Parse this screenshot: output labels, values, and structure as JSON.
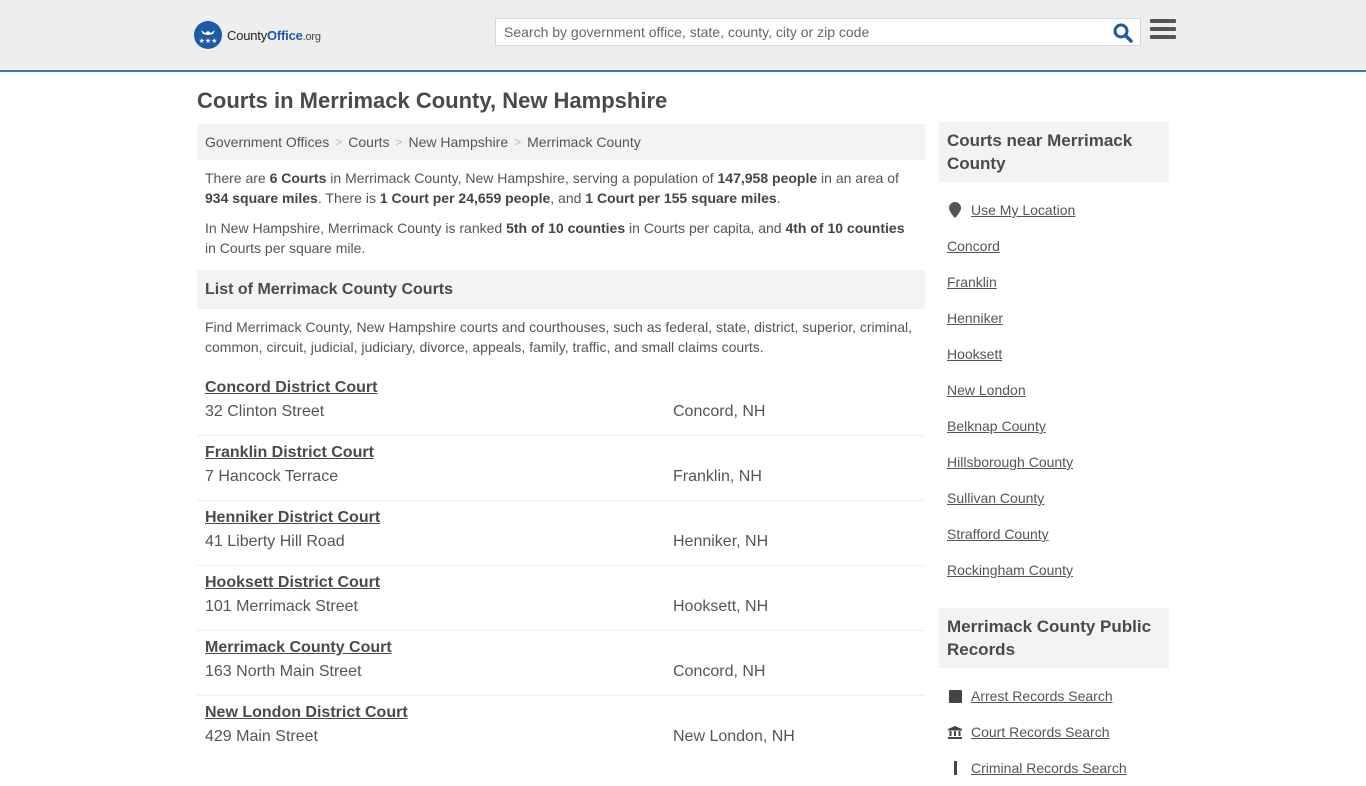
{
  "header": {
    "logo": {
      "part1": "County",
      "part2": "Office",
      "part3": ".org"
    },
    "search_placeholder": "Search by government office, state, county, city or zip code",
    "search_value": "",
    "accent_color": "#3a7aac"
  },
  "page_title": "Courts in Merrimack County, New Hampshire",
  "breadcrumb": [
    {
      "label": "Government Offices"
    },
    {
      "label": "Courts"
    },
    {
      "label": "New Hampshire"
    },
    {
      "label": "Merrimack County"
    }
  ],
  "intro": {
    "p1": {
      "t1": "There are ",
      "b1": "6 Courts",
      "t2": " in Merrimack County, New Hampshire, serving a population of ",
      "b2": "147,958 people",
      "t3": " in an area of ",
      "b3": "934 square miles",
      "t4": ". There is ",
      "b4": "1 Court per 24,659 people",
      "t5": ", and ",
      "b5": "1 Court per 155 square miles",
      "t6": "."
    },
    "p2": {
      "t1": "In New Hampshire, Merrimack County is ranked ",
      "b1": "5th of 10 counties",
      "t2": " in Courts per capita, and ",
      "b2": "4th of 10 counties",
      "t3": " in Courts per square mile."
    }
  },
  "list": {
    "heading": "List of Merrimack County Courts",
    "description": "Find Merrimack County, New Hampshire courts and courthouses, such as federal, state, district, superior, criminal, common, circuit, judicial, judiciary, divorce, appeals, family, traffic, and small claims courts.",
    "courts": [
      {
        "name": "Concord District Court",
        "address": "32 Clinton Street",
        "city": "Concord, NH"
      },
      {
        "name": "Franklin District Court",
        "address": "7 Hancock Terrace",
        "city": "Franklin, NH"
      },
      {
        "name": "Henniker District Court",
        "address": "41 Liberty Hill Road",
        "city": "Henniker, NH"
      },
      {
        "name": "Hooksett District Court",
        "address": "101 Merrimack Street",
        "city": "Hooksett, NH"
      },
      {
        "name": "Merrimack County Court",
        "address": "163 North Main Street",
        "city": "Concord, NH"
      },
      {
        "name": "New London District Court",
        "address": "429 Main Street",
        "city": "New London, NH"
      }
    ]
  },
  "sidebar": {
    "nearby_heading": "Courts near Merrimack County",
    "use_location": "Use My Location",
    "nearby": [
      "Concord",
      "Franklin",
      "Henniker",
      "Hooksett",
      "New London",
      "Belknap County",
      "Hillsborough County",
      "Sullivan County",
      "Strafford County",
      "Rockingham County"
    ],
    "records_heading": "Merrimack County Public Records",
    "records": [
      {
        "label": "Arrest Records Search",
        "icon": "square-icon"
      },
      {
        "label": "Court Records Search",
        "icon": "bank-icon"
      },
      {
        "label": "Criminal Records Search",
        "icon": "gavel-icon"
      }
    ]
  }
}
